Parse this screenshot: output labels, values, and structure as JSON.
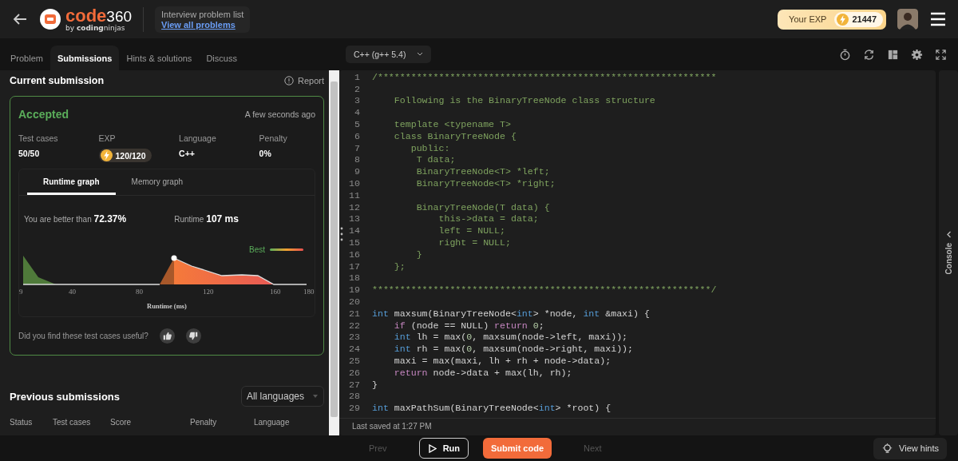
{
  "header": {
    "logo": {
      "word": "code",
      "number": "360",
      "byline": "by **coding**ninjas"
    },
    "problem_list": {
      "title": "Interview problem list",
      "link": "View all problems"
    },
    "exp": {
      "label": "Your EXP",
      "value": "21447"
    }
  },
  "tabs": [
    {
      "label": "Problem",
      "selected": false
    },
    {
      "label": "Submissions",
      "selected": true
    },
    {
      "label": "Hints & solutions",
      "selected": false
    },
    {
      "label": "Discuss",
      "selected": false
    }
  ],
  "current_submission": {
    "title": "Current submission",
    "report": "Report",
    "status": "Accepted",
    "time": "A few seconds ago",
    "stats": [
      {
        "label": "Test cases",
        "value": "50/50",
        "kind": "text"
      },
      {
        "label": "EXP",
        "value": "120/120",
        "kind": "exp"
      },
      {
        "label": "Language",
        "value": "C++",
        "kind": "text"
      },
      {
        "label": "Penalty",
        "value": "0%",
        "kind": "text"
      }
    ],
    "graph_tabs": [
      {
        "label": "Runtime graph",
        "selected": true
      },
      {
        "label": "Memory graph",
        "selected": false
      }
    ],
    "better_label": "You are better than",
    "better_value": "72.37%",
    "runtime_label": "Runtime",
    "runtime_value": "107 ms",
    "legend": "Best",
    "x_ticks": [
      "9",
      "40",
      "80",
      "120",
      "160",
      "180"
    ],
    "axis_label": "Runtime (ms)",
    "feedback": "Did you find these test cases useful?"
  },
  "previous_submissions": {
    "title": "Previous submissions",
    "filter": "All languages",
    "columns": [
      "Status",
      "Test cases",
      "Score",
      "Penalty",
      "Language"
    ]
  },
  "editor": {
    "language": "C++ (g++ 5.4)",
    "last_saved": "Last saved at 1:27 PM",
    "console": "Console",
    "lines": [
      {
        "number": "1",
        "tokens": [
          {
            "kind": "comment",
            "text": "/*************************************************************"
          }
        ]
      },
      {
        "number": "2"
      },
      {
        "number": "3",
        "tokens": [
          {
            "kind": "comment",
            "text": "    Following is the BinaryTreeNode class structure"
          }
        ]
      },
      {
        "number": "4"
      },
      {
        "number": "5",
        "tokens": [
          {
            "kind": "comment",
            "text": "    template <typename T>"
          }
        ]
      },
      {
        "number": "6",
        "tokens": [
          {
            "kind": "comment",
            "text": "    class BinaryTreeNode {"
          }
        ]
      },
      {
        "number": "7",
        "tokens": [
          {
            "kind": "comment",
            "text": "       public:"
          }
        ]
      },
      {
        "number": "8",
        "tokens": [
          {
            "kind": "comment",
            "text": "        T data;"
          }
        ]
      },
      {
        "number": "9",
        "tokens": [
          {
            "kind": "comment",
            "text": "        BinaryTreeNode<T> *left;"
          }
        ]
      },
      {
        "number": "10",
        "tokens": [
          {
            "kind": "comment",
            "text": "        BinaryTreeNode<T> *right;"
          }
        ]
      },
      {
        "number": "11"
      },
      {
        "number": "12",
        "tokens": [
          {
            "kind": "comment",
            "text": "        BinaryTreeNode(T data) {"
          }
        ]
      },
      {
        "number": "13",
        "tokens": [
          {
            "kind": "comment",
            "text": "            this->data = data;"
          }
        ]
      },
      {
        "number": "14",
        "tokens": [
          {
            "kind": "comment",
            "text": "            left = NULL;"
          }
        ]
      },
      {
        "number": "15",
        "tokens": [
          {
            "kind": "comment",
            "text": "            right = NULL;"
          }
        ]
      },
      {
        "number": "16",
        "tokens": [
          {
            "kind": "comment",
            "text": "        }"
          }
        ]
      },
      {
        "number": "17",
        "tokens": [
          {
            "kind": "comment",
            "text": "    };"
          }
        ]
      },
      {
        "number": "18"
      },
      {
        "number": "19",
        "tokens": [
          {
            "kind": "comment",
            "text": "*************************************************************/"
          }
        ]
      },
      {
        "number": "20"
      },
      {
        "number": "21",
        "tokens": [
          {
            "kind": "type",
            "text": "int"
          },
          {
            "kind": "plain",
            "text": " maxsum(BinaryTreeNode<"
          },
          {
            "kind": "type",
            "text": "int"
          },
          {
            "kind": "plain",
            "text": "> *node, "
          },
          {
            "kind": "type",
            "text": "int"
          },
          {
            "kind": "plain",
            "text": " &maxi) {"
          }
        ]
      },
      {
        "number": "22",
        "tokens": [
          {
            "kind": "keyword",
            "text": "    if"
          },
          {
            "kind": "plain",
            "text": " (node == NULL) "
          },
          {
            "kind": "keyword",
            "text": "return "
          },
          {
            "kind": "number",
            "text": "0"
          },
          {
            "kind": "plain",
            "text": ";"
          }
        ]
      },
      {
        "number": "23",
        "tokens": [
          {
            "kind": "type",
            "text": "    int"
          },
          {
            "kind": "plain",
            "text": " lh = max("
          },
          {
            "kind": "number",
            "text": "0"
          },
          {
            "kind": "plain",
            "text": ", maxsum(node->left, maxi));"
          }
        ]
      },
      {
        "number": "24",
        "tokens": [
          {
            "kind": "type",
            "text": "    int"
          },
          {
            "kind": "plain",
            "text": " rh = max("
          },
          {
            "kind": "number",
            "text": "0"
          },
          {
            "kind": "plain",
            "text": ", maxsum(node->right, maxi));"
          }
        ]
      },
      {
        "number": "25",
        "tokens": [
          {
            "kind": "plain",
            "text": "    maxi = max(maxi, lh + rh + node->data);"
          }
        ]
      },
      {
        "number": "26",
        "tokens": [
          {
            "kind": "keyword",
            "text": "    return"
          },
          {
            "kind": "plain",
            "text": " node->data + max(lh, rh);"
          }
        ]
      },
      {
        "number": "27",
        "tokens": [
          {
            "kind": "plain",
            "text": "}"
          }
        ]
      },
      {
        "number": "28"
      },
      {
        "number": "29",
        "tokens": [
          {
            "kind": "type",
            "text": "int"
          },
          {
            "kind": "plain",
            "text": " maxPathSum(BinaryTreeNode<"
          },
          {
            "kind": "type",
            "text": "int"
          },
          {
            "kind": "plain",
            "text": "> *root) {"
          }
        ]
      }
    ]
  },
  "footer": {
    "buttons": [
      {
        "label": "Prev",
        "kind": "ghost",
        "disabled": true
      },
      {
        "label": "Run",
        "kind": "outline"
      },
      {
        "label": "Submit code",
        "kind": "primary"
      },
      {
        "label": "Next",
        "kind": "ghost",
        "disabled": true
      }
    ],
    "hints": "View hints"
  }
}
